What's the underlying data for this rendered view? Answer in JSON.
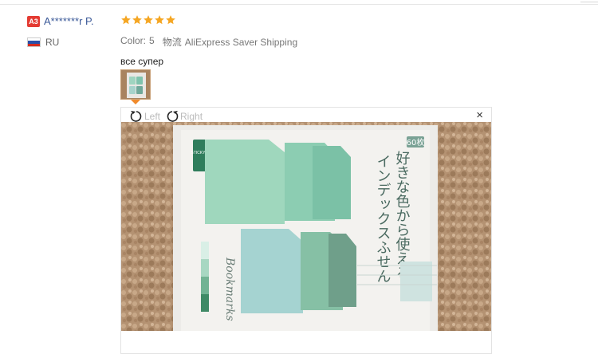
{
  "review": {
    "level_badge": "A3",
    "user_name": "A*******r P.",
    "country_code": "RU",
    "rating": 5,
    "color_label": "Color:",
    "color_value": "5",
    "shipping_label": "物流",
    "shipping_value": "AliExpress Saver Shipping",
    "text": "все супер"
  },
  "viewer": {
    "rotate_left_label": "Left",
    "rotate_right_label": "Right",
    "close_glyph": "×"
  },
  "photo": {
    "badge_text": "60枚",
    "jp_line1": "好きな色から使える",
    "jp_line2": "インデックスふせん",
    "brand": "Bookmarks",
    "label_small": "STICKY NOTE"
  },
  "colors": {
    "star": "#f5a623",
    "name_link": "#3b5998",
    "badge": "#e43b33",
    "caret": "#f08a2c"
  }
}
